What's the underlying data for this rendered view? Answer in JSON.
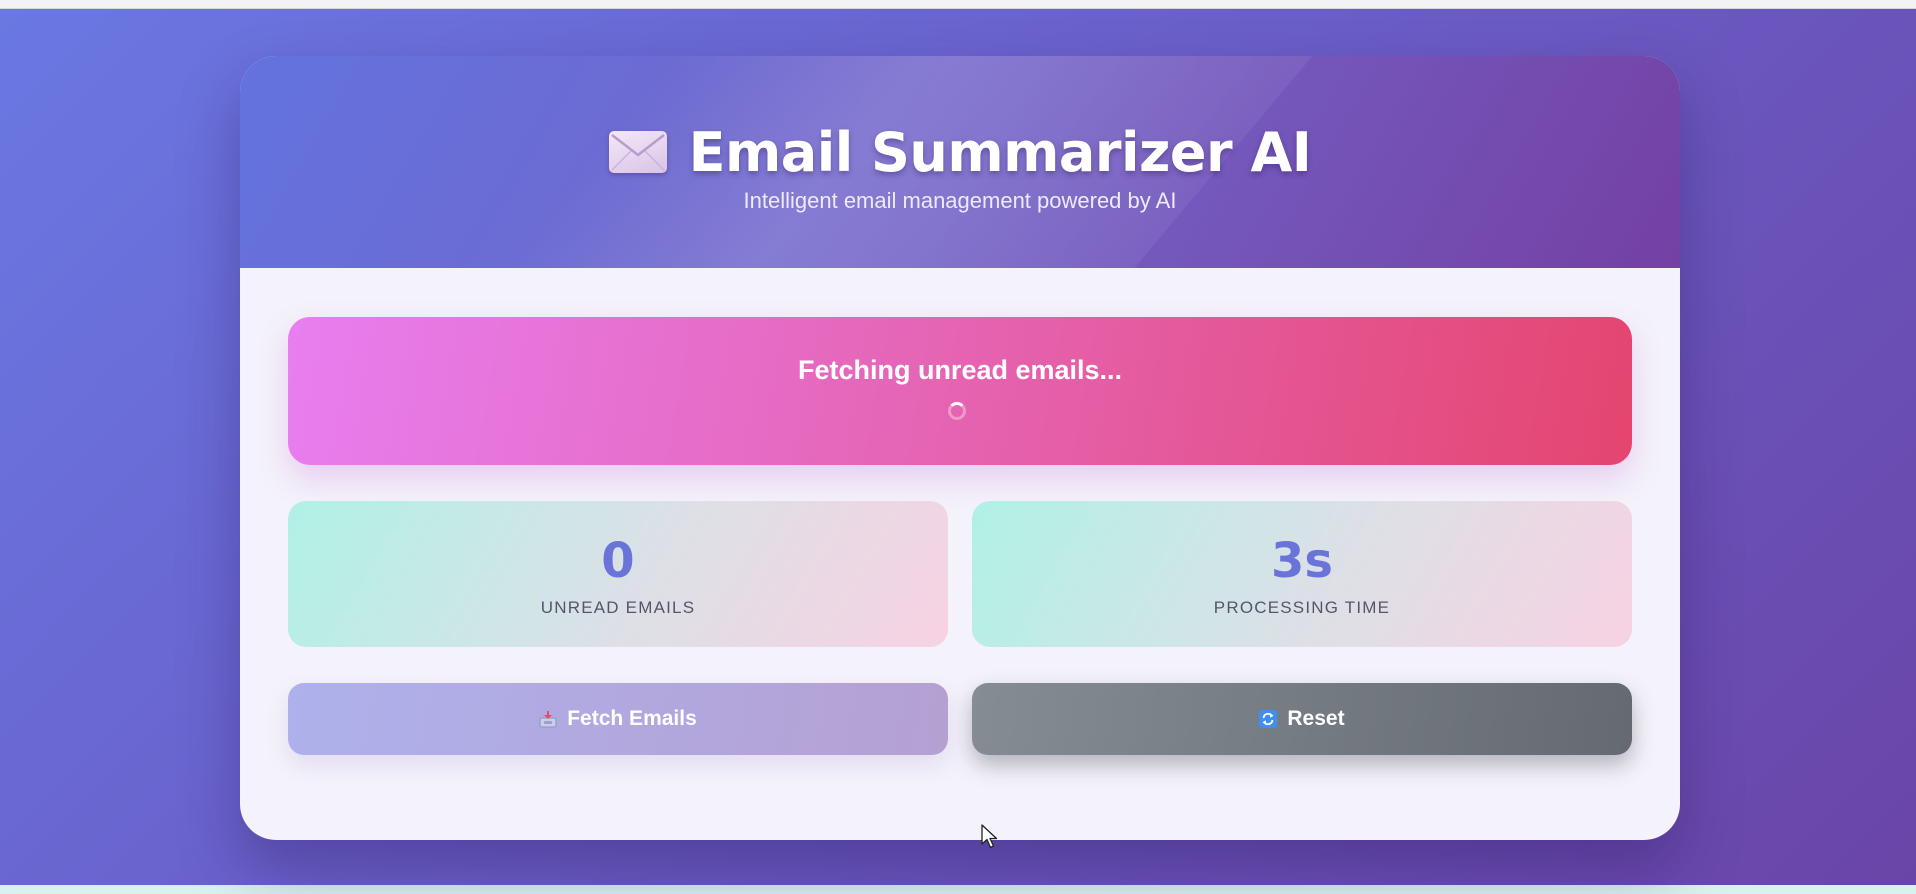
{
  "header": {
    "title": "Email Summarizer AI",
    "subtitle": "Intelligent email management powered by AI",
    "icon": "envelope-icon"
  },
  "status": {
    "message": "Fetching unread emails...",
    "loading": true
  },
  "stats": [
    {
      "value": "0",
      "label": "UNREAD EMAILS"
    },
    {
      "value": "3s",
      "label": "PROCESSING TIME"
    }
  ],
  "buttons": {
    "fetch": {
      "label": "Fetch Emails",
      "icon": "inbox-tray-icon",
      "disabled": true
    },
    "reset": {
      "label": "Reset",
      "icon": "refresh-icon"
    }
  },
  "colors": {
    "accent": "#6a73d8",
    "banner_start": "#e87ef0",
    "banner_end": "#e4456f",
    "header_start": "#6373df",
    "header_end": "#7440a4"
  }
}
